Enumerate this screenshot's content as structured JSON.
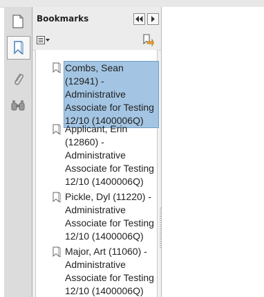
{
  "panel": {
    "title": "Bookmarks"
  },
  "icons": {
    "rail": [
      "pages-icon",
      "bookmark-icon",
      "attachment-icon",
      "search-icon"
    ],
    "header": [
      "collapse-left-icon",
      "expand-right-icon"
    ],
    "toolbar": [
      "options-menu-icon",
      "expand-bookmark-icon"
    ]
  },
  "bookmarks": [
    {
      "label": "Combs, Sean (12941) - Administrative Associate for Testing 12/10 (1400006Q)",
      "selected": true
    },
    {
      "label": "Applicant, Erin (12860) - Administrative Associate for Testing 12/10 (1400006Q)",
      "selected": false
    },
    {
      "label": "Pickle, Dyl (11220) - Administrative Associate for Testing 12/10 (1400006Q)",
      "selected": false
    },
    {
      "label": "Major, Art (11060) - Administrative Associate for Testing 12/10 (1400006Q)",
      "selected": false
    }
  ],
  "colors": {
    "selection": "#a3c5e3",
    "selection_border": "#6d9ec8",
    "bookmark_icon": "#4a7fbf"
  }
}
